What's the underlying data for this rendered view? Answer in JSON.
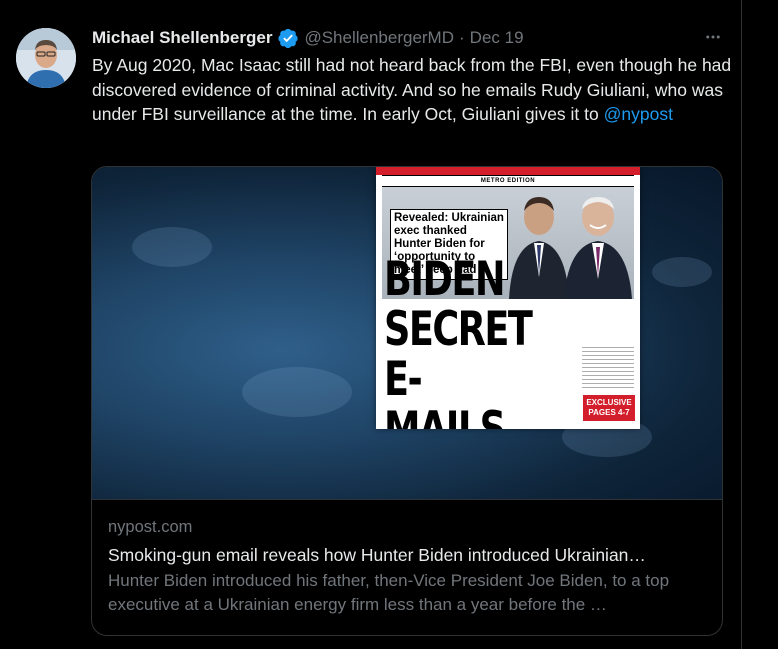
{
  "tweet": {
    "author": {
      "display_name": "Michael Shellenberger",
      "handle": "@ShellenbergerMD",
      "verified": true
    },
    "separator": "·",
    "date": "Dec 19",
    "more_icon": "more-horizontal-icon",
    "text_before_mention": "By Aug 2020, Mac Isaac still had not heard back from the FBI, even though he had discovered evidence of criminal activity. And so he emails Rudy Giuliani, who was under FBI surveillance at the time. In early Oct, Giuliani gives it to ",
    "mention": "@nypost",
    "accent_color": "#1d9bf0"
  },
  "link_card": {
    "domain": "nypost.com",
    "title": "Smoking-gun email reveals how Hunter Biden introduced Ukrainian…",
    "description": "Hunter Biden introduced his father, then-Vice President Joe Biden, to a top executive at a Ukrainian energy firm less than a year before the …",
    "image": {
      "edition_label": "METRO EDITION",
      "kicker": "Revealed: Ukrainian exec thanked Hunter Biden for ‘opportunity to meet’ veep dad",
      "headline_lines": [
        "BIDEN",
        "SECRET",
        "E-MAILS"
      ],
      "badge": "EXCLUSIVE PAGES 4-7"
    }
  }
}
